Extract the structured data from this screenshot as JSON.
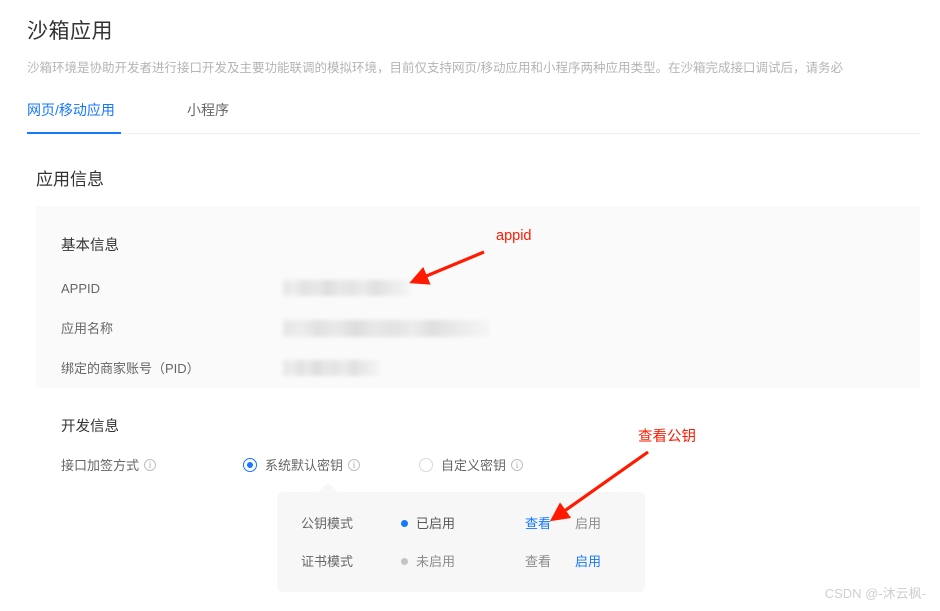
{
  "header": {
    "title": "沙箱应用",
    "description": "沙箱环境是协助开发者进行接口开发及主要功能联调的模拟环境，目前仅支持网页/移动应用和小程序两种应用类型。在沙箱完成接口调试后，请务必"
  },
  "tabs": [
    {
      "label": "网页/移动应用",
      "active": true
    },
    {
      "label": "小程序",
      "active": false
    }
  ],
  "section": {
    "title": "应用信息"
  },
  "basic_info": {
    "heading": "基本信息",
    "rows": [
      {
        "label": "APPID",
        "value": "",
        "redacted": true
      },
      {
        "label": "应用名称",
        "value": "",
        "redacted": true
      },
      {
        "label": "绑定的商家账号（PID）",
        "value": "",
        "redacted": true
      }
    ]
  },
  "dev_info": {
    "heading": "开发信息",
    "sign_method_label": "接口加签方式",
    "options": [
      {
        "label": "系统默认密钥",
        "selected": true
      },
      {
        "label": "自定义密钥",
        "selected": false
      }
    ]
  },
  "key_panel": {
    "rows": [
      {
        "name": "公钥模式",
        "status": "已启用",
        "enabled": true,
        "view_label": "查看",
        "enable_label": "启用",
        "view_is_link": true,
        "enable_is_link": false
      },
      {
        "name": "证书模式",
        "status": "未启用",
        "enabled": false,
        "view_label": "查看",
        "enable_label": "启用",
        "view_is_link": false,
        "enable_is_link": true
      }
    ]
  },
  "annotations": [
    {
      "text": "appid",
      "color": "#ff1a00"
    },
    {
      "text": "查看公钥",
      "color": "#ff1a00"
    }
  ],
  "watermark": "CSDN @-沐云枫-",
  "colors": {
    "accent": "#1677ff",
    "annotation": "#ff1a00",
    "panel_bg": "#fafafa",
    "popover_bg": "#f7f7f7"
  }
}
